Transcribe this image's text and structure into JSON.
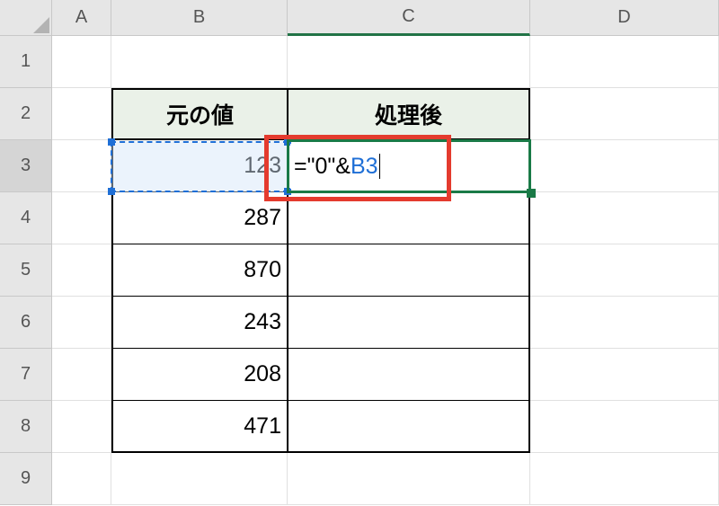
{
  "columns": [
    "A",
    "B",
    "C",
    "D"
  ],
  "rows": [
    "1",
    "2",
    "3",
    "4",
    "5",
    "6",
    "7",
    "8",
    "9"
  ],
  "headers": {
    "B": "元の値",
    "C": "処理後"
  },
  "values": {
    "B3": "123",
    "B4": "287",
    "B5": "870",
    "B6": "243",
    "B7": "208",
    "B8": "471"
  },
  "formula": {
    "prefix": "=\"0\"&",
    "ref": "B3"
  },
  "active_cell": "C3",
  "reference_cell": "B3"
}
